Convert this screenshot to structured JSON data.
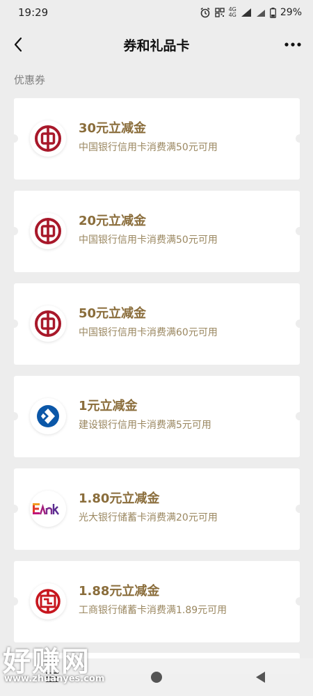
{
  "status_bar": {
    "time": "19:29",
    "battery": "29%",
    "network": "4G"
  },
  "nav": {
    "title": "券和礼品卡"
  },
  "section": {
    "label": "优惠券"
  },
  "coupons": [
    {
      "title": "30元立减金",
      "desc": "中国银行信用卡消费满50元可用",
      "logo": "boc-logo",
      "color": "#a8182a"
    },
    {
      "title": "20元立减金",
      "desc": "中国银行信用卡消费满50元可用",
      "logo": "boc-logo",
      "color": "#a8182a"
    },
    {
      "title": "50元立减金",
      "desc": "中国银行信用卡消费满60元可用",
      "logo": "boc-logo",
      "color": "#a8182a"
    },
    {
      "title": "1元立减金",
      "desc": "建设银行信用卡消费满5元可用",
      "logo": "ccb-logo",
      "color": "#0b57a8"
    },
    {
      "title": "1.80元立减金",
      "desc": "光大银行储蓄卡消费满20元可用",
      "logo": "ceb-logo",
      "color": "#e03a2c"
    },
    {
      "title": "1.88元立减金",
      "desc": "工商银行储蓄卡消费满1.89元可用",
      "logo": "icbc-logo",
      "color": "#c7161e"
    }
  ],
  "watermark": {
    "text": "好赚网",
    "url": "www.zhuanyes.com"
  },
  "colors": {
    "background": "#ededed",
    "coupon_title": "#8a6d3b",
    "coupon_desc": "#9a8760"
  }
}
